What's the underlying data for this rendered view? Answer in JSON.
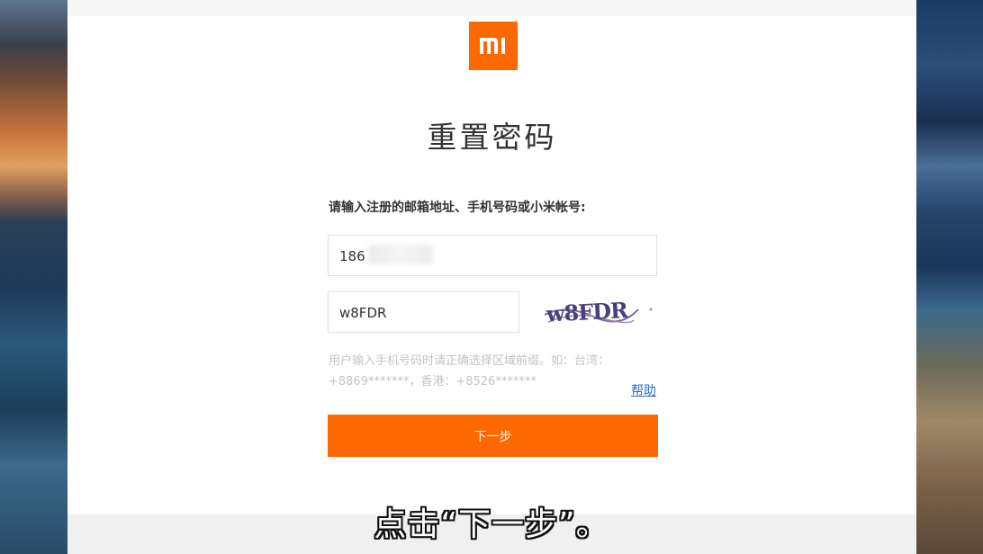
{
  "page": {
    "title": "重置密码",
    "prompt": "请输入注册的邮箱地址、手机号码或小米帐号:",
    "account_value": "186",
    "captcha_value": "w8FDR",
    "captcha_text": "w8FDR",
    "hint": "用户输入手机号码时请正确选择区域前缀。如：台湾：+8869*******，香港：+8526*******",
    "help_label": "帮助",
    "next_label": "下一步",
    "logo_text": "mi"
  },
  "subtitle": "点击“下一步”。",
  "colors": {
    "brand": "#ff6700",
    "link": "#2b6cc4"
  }
}
